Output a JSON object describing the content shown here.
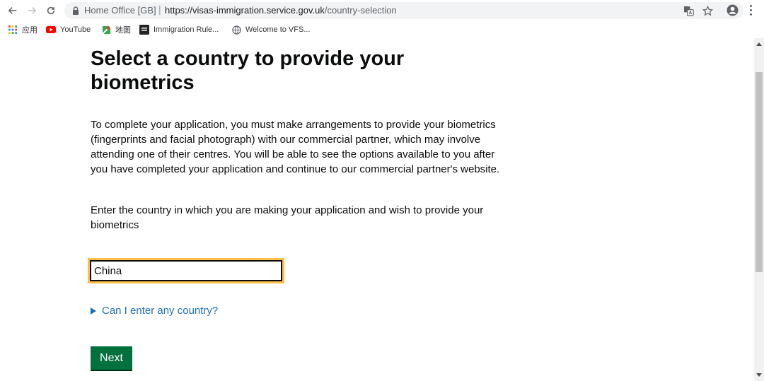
{
  "browser": {
    "site_name": "Home Office [GB]",
    "url_host": "https://visas-immigration.service.gov.uk",
    "url_path": "/country-selection",
    "bookmarks": [
      {
        "label": "应用",
        "icon": "apps-grid-icon"
      },
      {
        "label": "YouTube",
        "icon": "youtube-icon"
      },
      {
        "label": "地图",
        "icon": "maps-icon"
      },
      {
        "label": "Immigration Rule...",
        "icon": "document-icon"
      },
      {
        "label": "Welcome to VFS...",
        "icon": "globe-icon"
      }
    ]
  },
  "page": {
    "title": "Select a country to provide your biometrics",
    "intro": "To complete your application, you must make arrangements to provide your biometrics (fingerprints and facial photograph) with our commercial partner, which may involve attending one of their centres. You will be able to see the options available to you after you have completed your application and continue to our commercial partner's website.",
    "instruction": "Enter the country in which you are making your application and wish to provide your biometrics",
    "country_value": "China",
    "details_label": "Can I enter any country?",
    "next_label": "Next"
  },
  "colors": {
    "link": "#1d70b8",
    "button": "#00703c",
    "focus": "#ffbf47"
  }
}
